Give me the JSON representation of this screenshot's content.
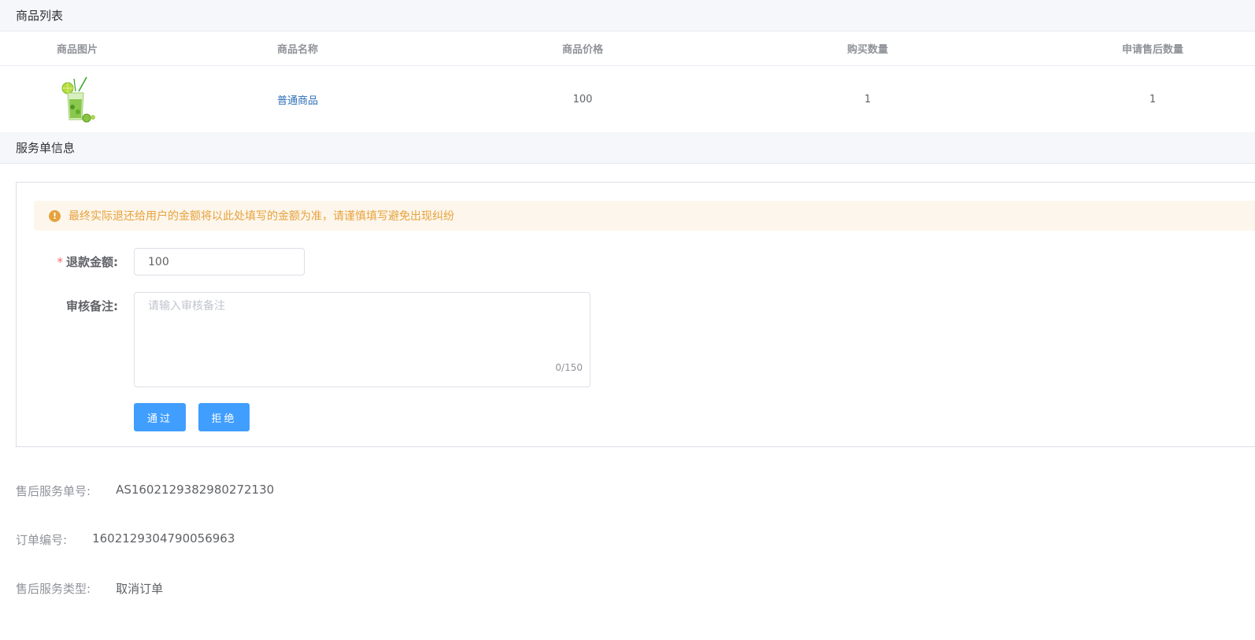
{
  "goods_section": {
    "title": "商品列表",
    "columns": [
      "商品图片",
      "商品名称",
      "商品价格",
      "购买数量",
      "申请售后数量"
    ],
    "rows": [
      {
        "name": "普通商品",
        "price": "100",
        "quantity": "1",
        "aftersale_quantity": "1"
      }
    ]
  },
  "service_section": {
    "title": "服务单信息",
    "alert": "最终实际退还给用户的金额将以此处填写的金额为准，请谨慎填写避免出现纠纷",
    "refund_label": "退款金额:",
    "refund_required_mark": "*",
    "refund_value": "100",
    "note_label": "审核备注:",
    "note_placeholder": "请输入审核备注",
    "note_counter": "0/150",
    "approve_label": "通过",
    "reject_label": "拒绝"
  },
  "info": {
    "as_label": "售后服务单号:",
    "as_value": "AS1602129382980272130",
    "order_label": "订单编号:",
    "order_value": "1602129304790056963",
    "type_label": "售后服务类型:",
    "type_value": "取消订单"
  },
  "colors": {
    "primary": "#409eff",
    "warning": "#e6a23c",
    "danger": "#f56c6c",
    "link": "#2d6eb5"
  }
}
